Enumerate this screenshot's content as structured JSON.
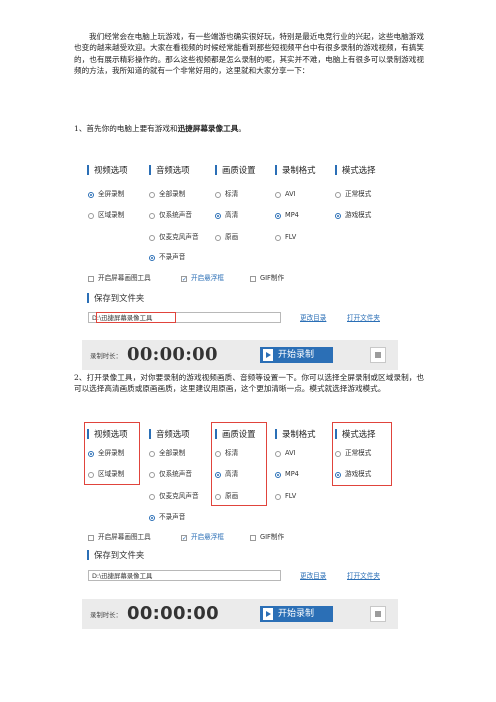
{
  "doc": {
    "intro": "我们经常会在电脑上玩游戏，有一些端游也确实很好玩，特别是最近电竞行业的兴起，这些电脑游戏也变的越来越受欢迎。大家在看视频的时候经常能看到那些短视频平台中有很多录制的游戏视频，有搞笑的，也有展示精彩操作的。那么这些视频都是怎么录制的呢，其实并不难，电脑上有很多可以录制游戏视频的方法，我所知道的就有一个非常好用的，这里就和大家分享一下：",
    "step1_prefix": "1、首先你的电脑上要有游戏和",
    "step1_bold": "迅捷屏幕录像工具",
    "step1_suffix": "。",
    "step2": "2、打开录像工具，对你要录制的游戏视频画质、音频等设置一下。你可以选择全屏录制或区域录制，也可以选择高清画质或原画画质，这里建议用原画，这个更加清晰一点。模式就选择游戏模式。"
  },
  "recorder": {
    "columns": {
      "video": "视频选项",
      "audio": "音频选项",
      "quality": "画质设置",
      "format": "录制格式",
      "mode": "模式选择"
    },
    "video_options": [
      "全屏录制",
      "区域录制"
    ],
    "audio_options": [
      "全部录制",
      "仅系统声音",
      "仅麦克风声音",
      "不录声音"
    ],
    "quality_options": [
      "标清",
      "高清",
      "原画"
    ],
    "format_options": [
      "AVI",
      "MP4",
      "FLV"
    ],
    "mode_options": [
      "正常模式",
      "游戏模式"
    ],
    "checkboxes": [
      "开启屏幕画图工具",
      "开启悬浮框",
      "GIF制作"
    ],
    "save_title": "保存到文件夹",
    "path1": "D:\\迅捷屏幕录像工具",
    "path2": "D:\\迅捷屏幕录像工具",
    "change_dir": "更改目录",
    "open_dir": "打开文件夹",
    "duration_label": "录制时长：",
    "timer": "00:00:00",
    "start_label": "开始录制",
    "accent": "#2b6fb6",
    "highlight": "#e0443c"
  }
}
